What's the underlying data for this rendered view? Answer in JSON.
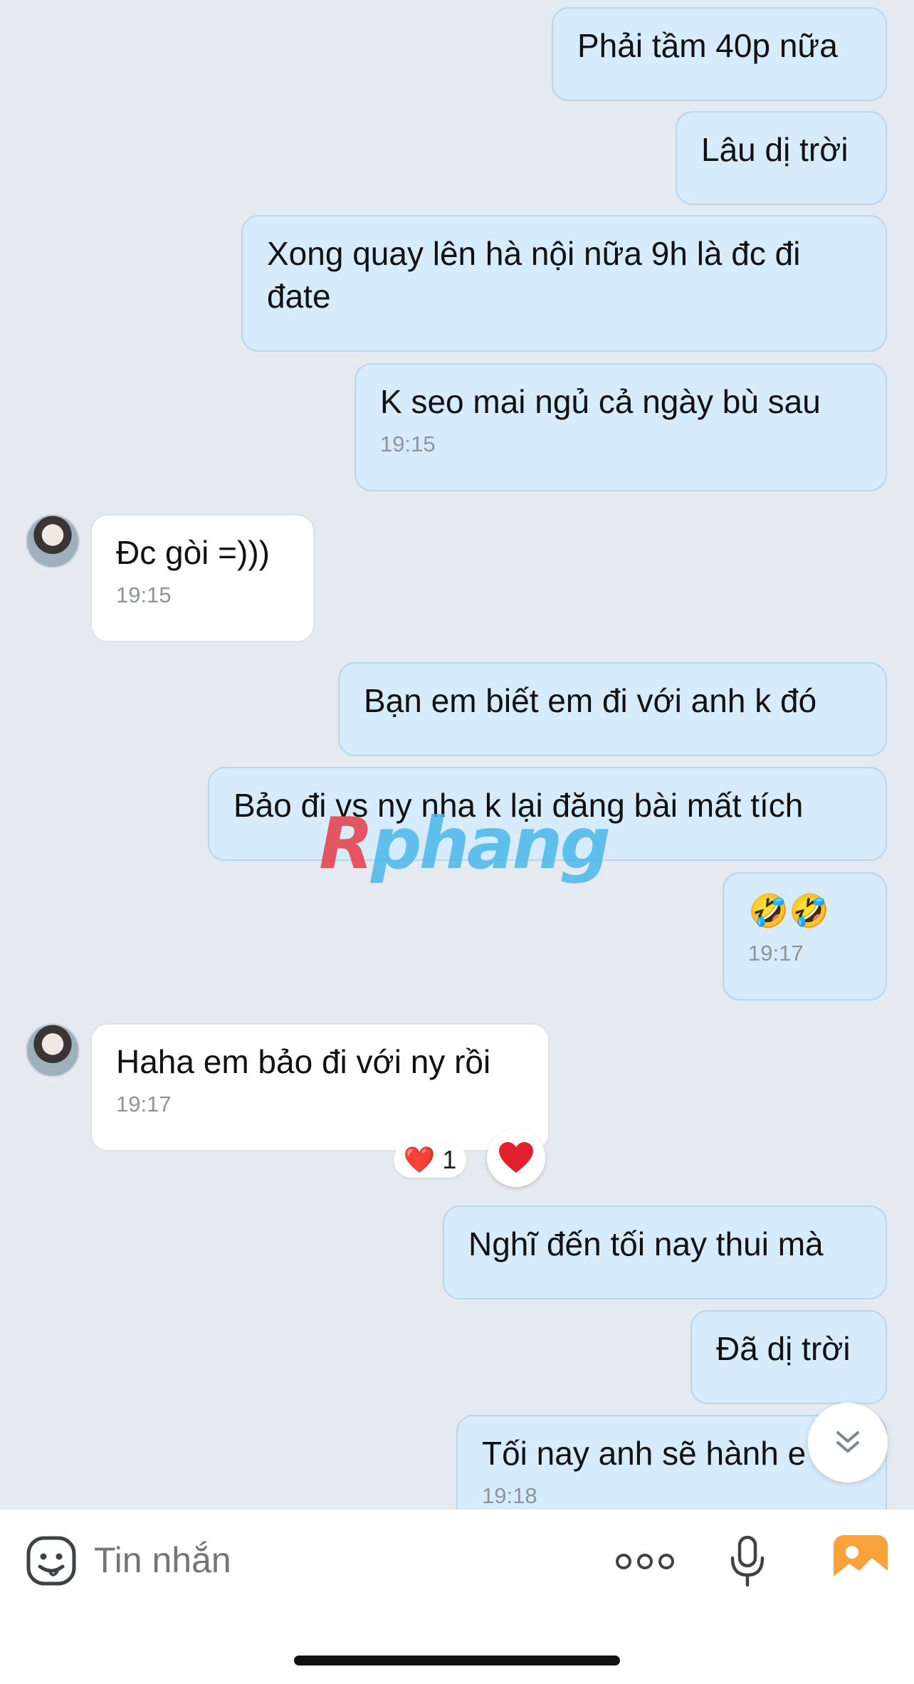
{
  "messages": [
    {
      "side": "out",
      "text": "Phải tầm 40p nữa"
    },
    {
      "side": "out",
      "text": "Lâu dị trời"
    },
    {
      "side": "out",
      "text": "Xong quay lên hà nội nữa 9h là đc đi đate"
    },
    {
      "side": "out",
      "text": "K seo mai ngủ cả ngày bù sau",
      "time": "19:15"
    },
    {
      "side": "in",
      "text": "Đc gòi =)))",
      "time": "19:15"
    },
    {
      "side": "out",
      "text": "Bạn em biết em đi với anh k đó"
    },
    {
      "side": "out",
      "text": "Bảo đi vs ny nha k lại đăng bài mất tích"
    },
    {
      "side": "out",
      "text": "🤣🤣",
      "time": "19:17"
    },
    {
      "side": "in",
      "text": "Haha em bảo đi với ny rồi",
      "time": "19:17",
      "reaction": {
        "emoji": "❤️",
        "count": "1"
      }
    },
    {
      "side": "out",
      "text": "Nghĩ đến tối nay thui mà"
    },
    {
      "side": "out",
      "text": "Đã dị trời"
    },
    {
      "side": "out",
      "text": "Tối nay anh sẽ hành e",
      "time": "19:18"
    }
  ],
  "reaction_button": {
    "emoji": "❤️"
  },
  "watermark": {
    "first": "R",
    "rest": "phang"
  },
  "input": {
    "placeholder": "Tin nhắn"
  },
  "colors": {
    "outgoing_bubble": "#d6ebfc",
    "incoming_bubble": "#ffffff",
    "background": "#e5e9f0",
    "accent": "#f7a23b"
  },
  "icons": [
    "emoji-sticker-icon",
    "more-icon",
    "microphone-icon",
    "image-gallery-icon",
    "scroll-down-icon",
    "heart-icon"
  ]
}
